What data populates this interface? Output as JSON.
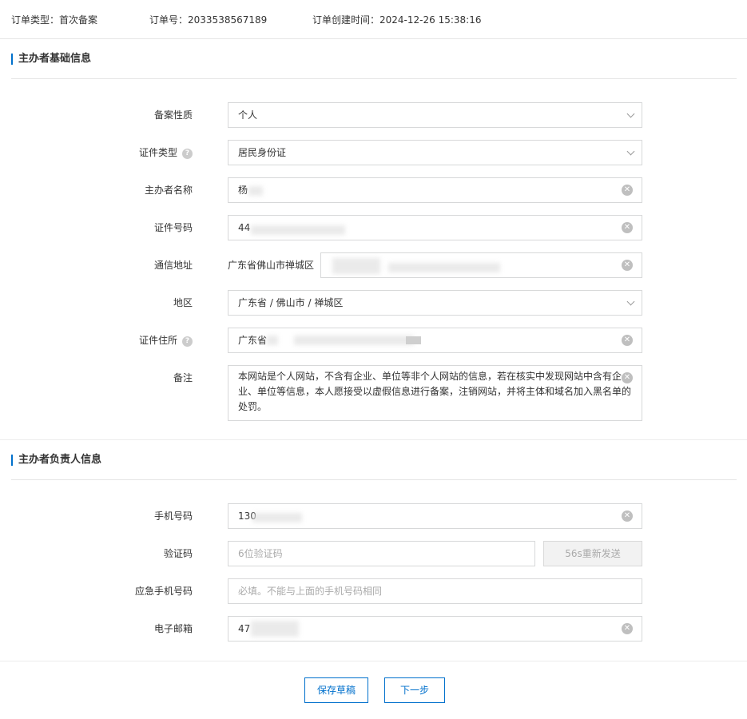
{
  "order": {
    "type_key": "订单类型：",
    "type_value": "首次备案",
    "no_key": "订单号：",
    "no_value": "2033538567189",
    "created_key": "订单创建时间：",
    "created_value": "2024-12-26 15:38:16"
  },
  "section1": {
    "title": "主办者基础信息",
    "fields": {
      "nature": {
        "label": "备案性质",
        "value": "个人"
      },
      "id_type": {
        "label": "证件类型",
        "value": "居民身份证"
      },
      "name": {
        "label": "主办者名称",
        "value": "杨"
      },
      "id_no": {
        "label": "证件号码",
        "value": "44"
      },
      "address": {
        "label": "通信地址",
        "prefix": "广东省佛山市禅城区",
        "value": ""
      },
      "region": {
        "label": "地区",
        "value": "广东省 / 佛山市 / 禅城区"
      },
      "id_address": {
        "label": "证件住所",
        "value": "广东省"
      },
      "remark": {
        "label": "备注",
        "value": "本网站是个人网站，不含有企业、单位等非个人网站的信息，若在核实中发现网站中含有企业、单位等信息，本人愿接受以虚假信息进行备案，注销网站，并将主体和域名加入黑名单的处罚。"
      }
    }
  },
  "section2": {
    "title": "主办者负责人信息",
    "fields": {
      "phone": {
        "label": "手机号码",
        "value": "130"
      },
      "code": {
        "label": "验证码",
        "placeholder": "6位验证码",
        "resend": "56s重新发送"
      },
      "emergency_phone": {
        "label": "应急手机号码",
        "placeholder": "必填。不能与上面的手机号码相同"
      },
      "email": {
        "label": "电子邮箱",
        "value": "47"
      }
    }
  },
  "actions": {
    "save_draft": "保存草稿",
    "next": "下一步"
  },
  "colors": {
    "accent": "#0070cc",
    "border": "#d7d8d9"
  }
}
